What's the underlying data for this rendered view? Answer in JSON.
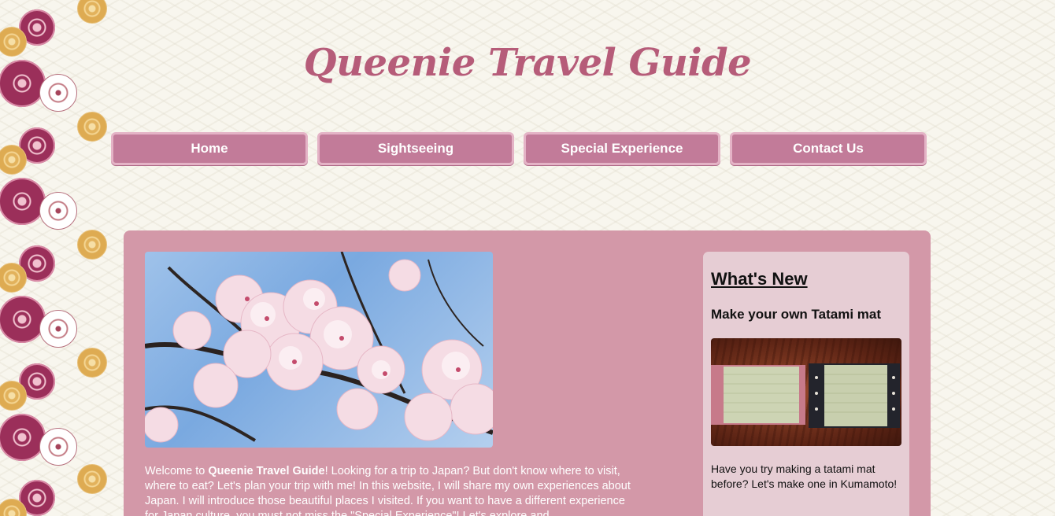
{
  "site": {
    "title": "Queenie Travel Guide"
  },
  "nav": {
    "items": [
      {
        "label": "Home"
      },
      {
        "label": "Sightseeing"
      },
      {
        "label": "Special Experience"
      },
      {
        "label": "Contact Us"
      }
    ]
  },
  "main": {
    "intro": {
      "prefix": "Welcome to ",
      "brand": "Queenie Travel Guide",
      "body": "! Looking for a trip to Japan? But don't know where to visit, where to eat? Let's plan your trip with me! In this website, I will share my own experiences about Japan. I will introduce those beautiful places I visited. If you want to have a different experience for Japan culture, you must not miss the \"Special Experience\"! Let's explore and"
    }
  },
  "whats_new": {
    "heading": "What's New",
    "title": "Make your own Tatami mat",
    "text": "Have you try making a tatami mat before? Let's make one in Kumamoto!"
  },
  "colors": {
    "title": "#b65c79",
    "nav_button": "#c27b99",
    "nav_border": "#e4b3c6",
    "panel": "#d398a8",
    "news_box": "#e6cdd4"
  }
}
